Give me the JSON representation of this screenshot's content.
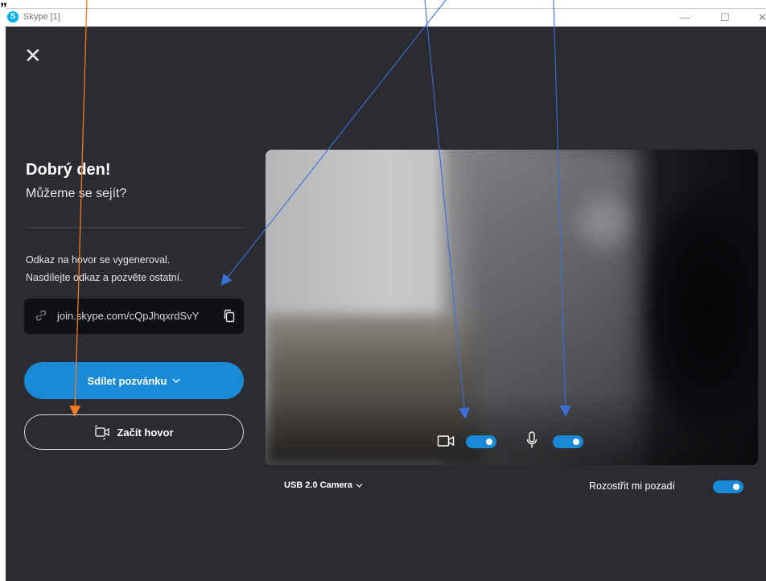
{
  "top_clip_text": "„ ",
  "titlebar": {
    "title": "Skype [1]",
    "logo_letter": "S",
    "min_glyph": "—",
    "max_glyph": "☐",
    "close_glyph": "✕"
  },
  "left": {
    "close_glyph": "✕",
    "greeting": "Dobrý den!",
    "subgreeting": "Můžeme se sejít?",
    "info_line1": "Odkaz na hovor se vygeneroval.",
    "info_line2": "Nasdílejte odkaz a pozvěte ostatní.",
    "link": "join.skype.com/cQpJhqxrdSvY",
    "share_label": "Sdílet pozvánku",
    "call_label": "Začít hovor"
  },
  "preview": {
    "video_on": true,
    "mic_on": true,
    "camera_name": "USB 2.0 Camera",
    "blur_label": "Rozostřit mi pozadí",
    "blur_on": true
  },
  "colors": {
    "accent": "#1a8ad6",
    "app_bg": "#2b2c31",
    "link_bg": "#0f1013",
    "arrow_blue": "#3b6fd8",
    "arrow_orange": "#f07a20"
  }
}
